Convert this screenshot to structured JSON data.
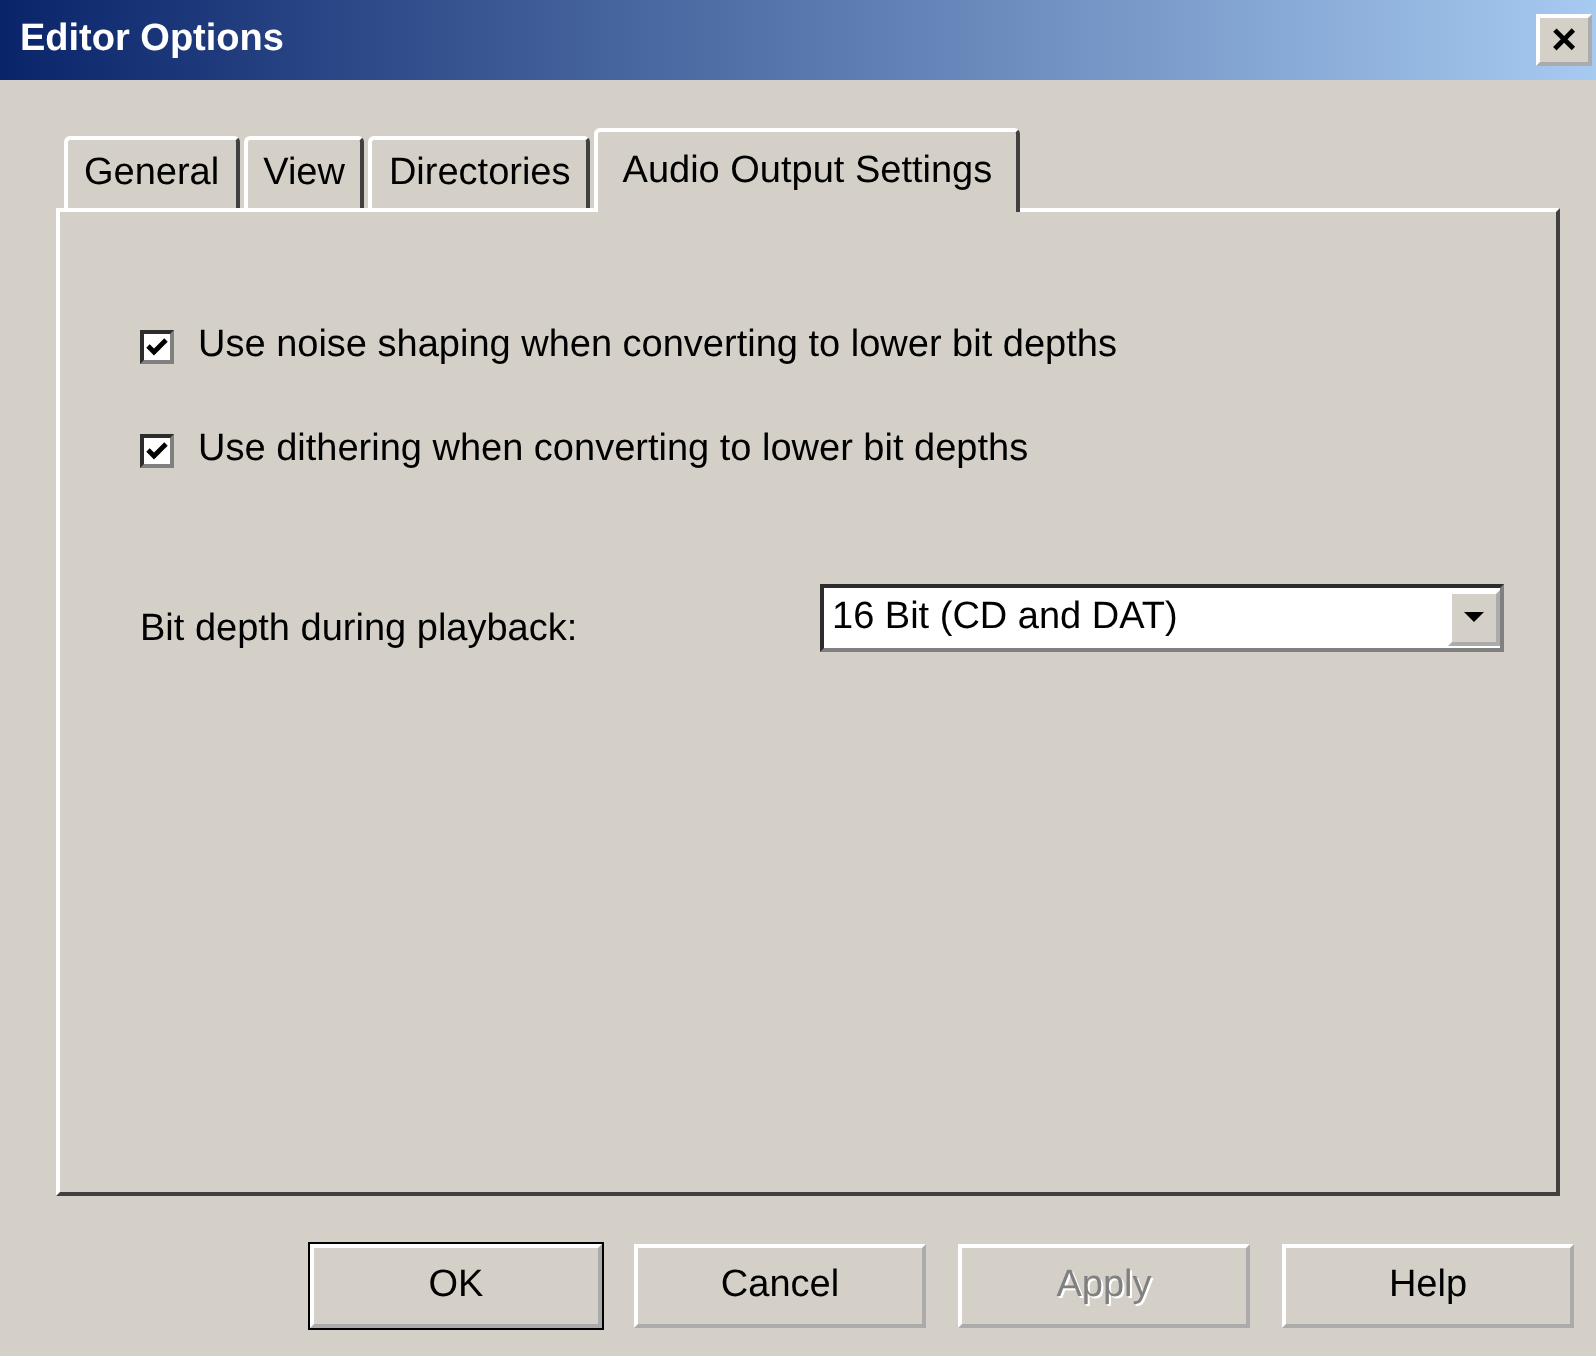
{
  "window": {
    "title": "Editor Options",
    "close": "×"
  },
  "tabs": [
    {
      "label": "General",
      "selected": false
    },
    {
      "label": "View",
      "selected": false
    },
    {
      "label": "Directories",
      "selected": false
    },
    {
      "label": "Audio Output Settings",
      "selected": true
    }
  ],
  "options": [
    {
      "label": "Use noise shaping when converting to lower bit depths",
      "checked": true
    },
    {
      "label": "Use dithering when converting to lower bit depths",
      "checked": true
    }
  ],
  "bit_depth": {
    "label": "Bit depth during playback:",
    "value": "16 Bit (CD and DAT)"
  },
  "buttons": [
    {
      "label": "OK",
      "disabled": false,
      "default": true
    },
    {
      "label": "Cancel",
      "disabled": false,
      "default": false
    },
    {
      "label": "Apply",
      "disabled": true,
      "default": false
    },
    {
      "label": "Help",
      "disabled": false,
      "default": false
    }
  ]
}
